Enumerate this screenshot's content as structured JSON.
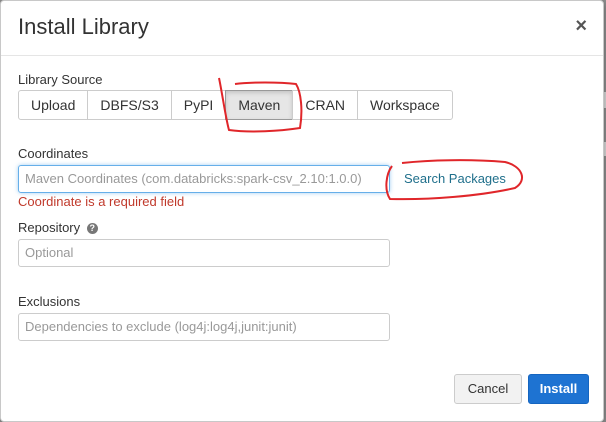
{
  "dialog": {
    "title": "Install Library",
    "close_glyph": "×"
  },
  "library_source": {
    "label": "Library Source",
    "tabs": [
      {
        "label": "Upload",
        "active": false
      },
      {
        "label": "DBFS/S3",
        "active": false
      },
      {
        "label": "PyPI",
        "active": false
      },
      {
        "label": "Maven",
        "active": true
      },
      {
        "label": "CRAN",
        "active": false
      },
      {
        "label": "Workspace",
        "active": false
      }
    ]
  },
  "coordinates": {
    "label": "Coordinates",
    "placeholder": "Maven Coordinates (com.databricks:spark-csv_2.10:1.0.0)",
    "error": "Coordinate is a required field",
    "search_link": "Search Packages"
  },
  "repository": {
    "label": "Repository",
    "help_icon": "question-circle-icon",
    "placeholder": "Optional"
  },
  "exclusions": {
    "label": "Exclusions",
    "placeholder": "Dependencies to exclude (log4j:log4j,junit:junit)"
  },
  "footer": {
    "cancel_label": "Cancel",
    "install_label": "Install"
  },
  "colors": {
    "primary": "#1e73d2",
    "error": "#c0392b",
    "link": "#1f6f8b",
    "annotation": "#e0262a"
  }
}
